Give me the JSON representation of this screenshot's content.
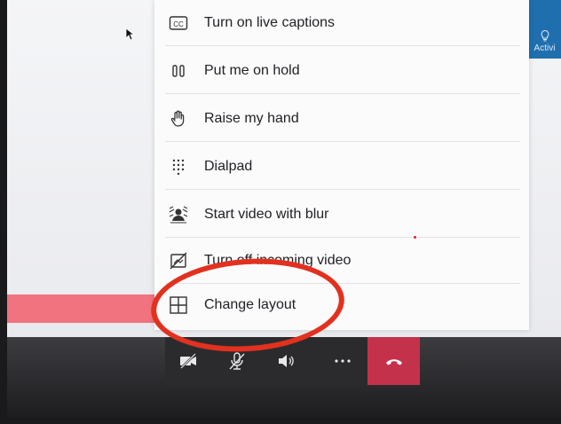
{
  "menu": {
    "items": [
      {
        "label": "Turn on live captions",
        "icon": "captions-icon"
      },
      {
        "label": "Put me on hold",
        "icon": "hold-icon"
      },
      {
        "label": "Raise my hand",
        "icon": "raise-hand-icon"
      },
      {
        "label": "Dialpad",
        "icon": "dialpad-icon"
      },
      {
        "label": "Start video with blur",
        "icon": "video-blur-icon"
      },
      {
        "label": "Turn off incoming video",
        "icon": "incoming-video-off-icon"
      },
      {
        "label": "Change layout",
        "icon": "layout-grid-icon"
      }
    ]
  },
  "side_panel": {
    "activity_label": "Activi",
    "icon": "lightbulb-icon"
  },
  "call_controls": {
    "buttons": [
      {
        "name": "camera-off-icon"
      },
      {
        "name": "mic-muted-icon"
      },
      {
        "name": "speaker-icon"
      },
      {
        "name": "more-options-icon"
      },
      {
        "name": "hang-up-icon"
      }
    ]
  },
  "colors": {
    "activity_blue": "#1f6fae",
    "hangup_red": "#c4314b",
    "annotation_red": "#e2311f"
  }
}
